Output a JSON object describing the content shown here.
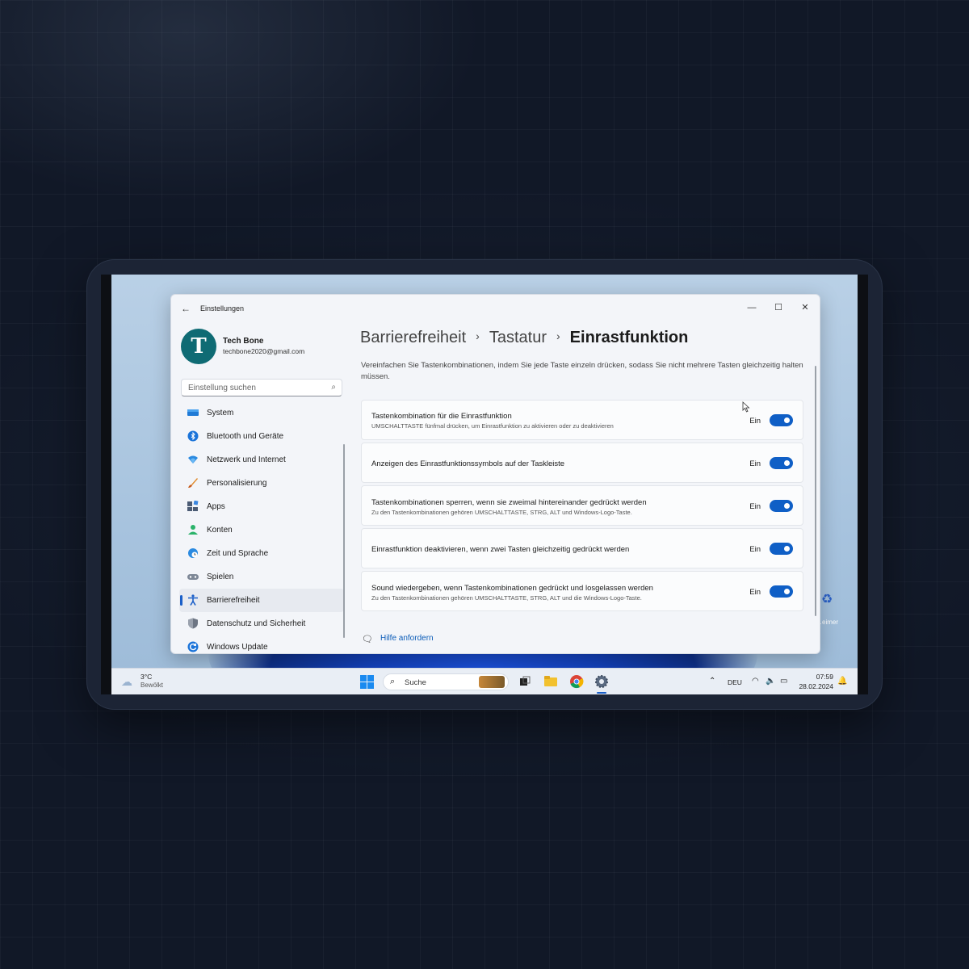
{
  "window": {
    "title": "Einstellungen",
    "minimize": "—",
    "maximize": "☐",
    "close": "✕"
  },
  "user": {
    "initial": "T",
    "name": "Tech Bone",
    "email": "techbone2020@gmail.com"
  },
  "search": {
    "placeholder": "Einstellung suchen"
  },
  "sidebar": {
    "items": [
      {
        "label": "System",
        "icon": "system-icon",
        "active": false
      },
      {
        "label": "Bluetooth und Geräte",
        "icon": "bluetooth-icon",
        "active": false
      },
      {
        "label": "Netzwerk und Internet",
        "icon": "network-icon",
        "active": false
      },
      {
        "label": "Personalisierung",
        "icon": "brush-icon",
        "active": false
      },
      {
        "label": "Apps",
        "icon": "apps-icon",
        "active": false
      },
      {
        "label": "Konten",
        "icon": "account-icon",
        "active": false
      },
      {
        "label": "Zeit und Sprache",
        "icon": "globe-clock-icon",
        "active": false
      },
      {
        "label": "Spielen",
        "icon": "gamepad-icon",
        "active": false
      },
      {
        "label": "Barrierefreiheit",
        "icon": "accessibility-icon",
        "active": true
      },
      {
        "label": "Datenschutz und Sicherheit",
        "icon": "shield-icon",
        "active": false
      },
      {
        "label": "Windows Update",
        "icon": "update-icon",
        "active": false
      }
    ]
  },
  "breadcrumb": {
    "level1": "Barrierefreiheit",
    "level2": "Tastatur",
    "current": "Einrastfunktion",
    "separator": "›"
  },
  "description": "Vereinfachen Sie Tastenkombinationen, indem Sie jede Taste einzeln drücken, sodass Sie nicht mehrere Tasten gleichzeitig halten müssen.",
  "settings": [
    {
      "title": "Tastenkombination für die Einrastfunktion",
      "subtitle": "UMSCHALTTASTE fünfmal drücken, um Einrastfunktion zu aktivieren oder zu deaktivieren",
      "state": "Ein",
      "on": true
    },
    {
      "title": "Anzeigen des Einrastfunktionssymbols auf der Taskleiste",
      "subtitle": "",
      "state": "Ein",
      "on": true
    },
    {
      "title": "Tastenkombinationen sperren, wenn sie zweimal hintereinander gedrückt werden",
      "subtitle": "Zu den Tastenkombinationen gehören UMSCHALTTASTE, STRG, ALT und Windows-Logo-Taste.",
      "state": "Ein",
      "on": true
    },
    {
      "title": "Einrastfunktion deaktivieren, wenn zwei Tasten gleichzeitig gedrückt werden",
      "subtitle": "",
      "state": "Ein",
      "on": true
    },
    {
      "title": "Sound wiedergeben, wenn Tastenkombinationen gedrückt und losgelassen werden",
      "subtitle": "Zu den Tastenkombinationen gehören UMSCHALTTASTE, STRG, ALT und die Windows-Logo-Taste.",
      "state": "Ein",
      "on": true
    }
  ],
  "help": {
    "label": "Hilfe anfordern"
  },
  "taskbar": {
    "weather_temp": "3°C",
    "weather_desc": "Bewölkt",
    "search_placeholder": "Suche",
    "language": "DEU",
    "time": "07:59",
    "date": "28.02.2024"
  },
  "colors": {
    "accent": "#0f5fc6",
    "link": "#0b5cb8",
    "avatar": "#0f6b74"
  }
}
